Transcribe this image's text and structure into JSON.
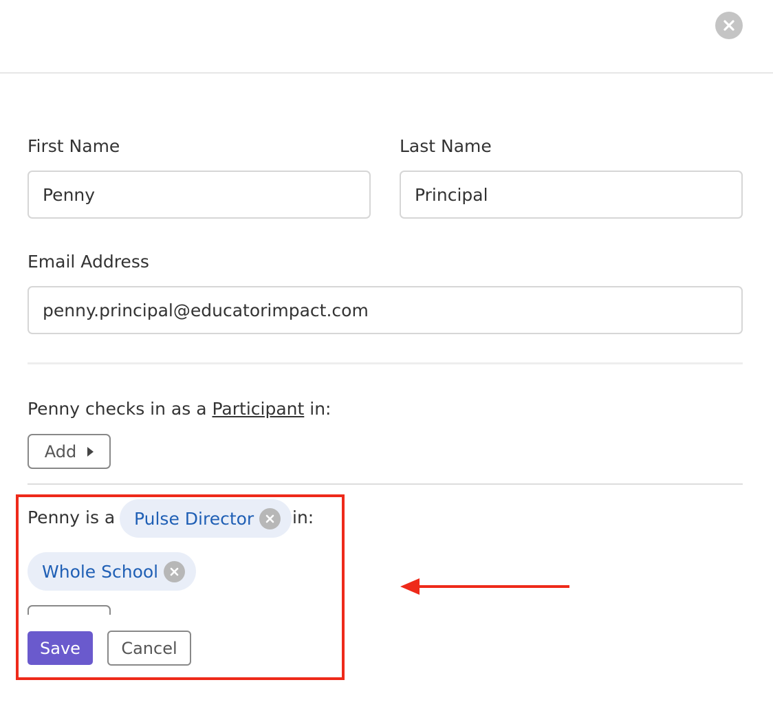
{
  "modal": {
    "close_icon": "close-icon"
  },
  "form": {
    "first_name": {
      "label": "First Name",
      "value": "Penny"
    },
    "last_name": {
      "label": "Last Name",
      "value": "Principal"
    },
    "email": {
      "label": "Email Address",
      "value": "penny.principal@educatorimpact.com"
    }
  },
  "participant_section": {
    "prefix": "Penny checks in as a",
    "role_link": "Participant",
    "suffix": "in:",
    "add_label": "Add",
    "add_icon": "caret-right-icon"
  },
  "role_section": {
    "prefix": "Penny is a",
    "role_chip": "Pulse Director",
    "suffix": "in:",
    "group_chip": "Whole School",
    "chip_remove_icon": "close-circle-icon"
  },
  "actions": {
    "save_label": "Save",
    "cancel_label": "Cancel"
  },
  "annotation": {
    "highlight_color": "#ee2a1a",
    "arrow_icon": "arrow-left-icon"
  },
  "colors": {
    "primary": "#6a5acd",
    "chip_background": "#e9eef8",
    "chip_text": "#1f5fb5"
  }
}
